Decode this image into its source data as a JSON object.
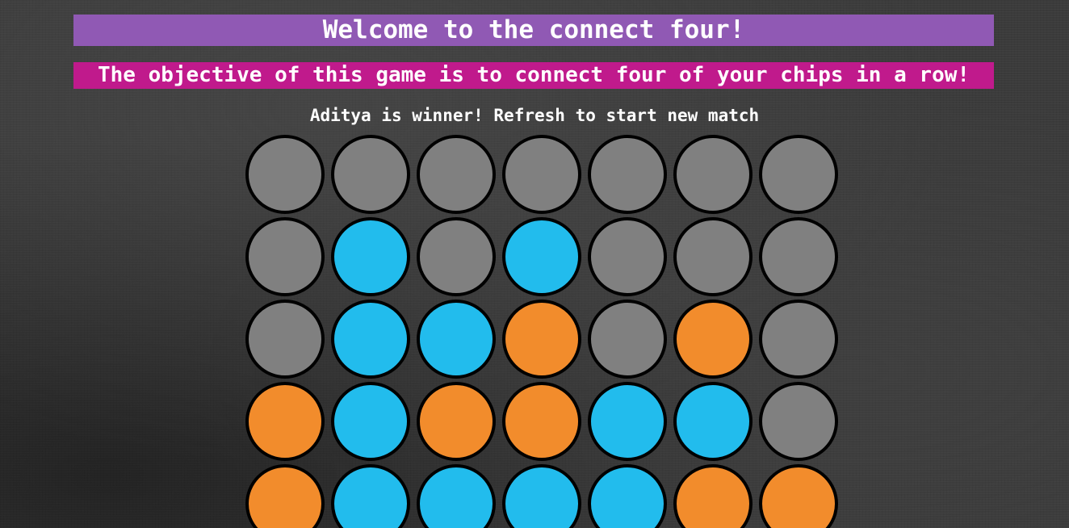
{
  "header": {
    "title": "Welcome to the connect four!",
    "subtitle": "The objective of this game is to connect four of your chips in a row!"
  },
  "status": {
    "message": "Aditya is winner! Refresh to start new match"
  },
  "colors": {
    "title_bg": "#9059b4",
    "subtitle_bg": "#c01a8c",
    "empty": "#808080",
    "blue": "#22bced",
    "orange": "#f28c2c",
    "cell_border": "#000000"
  },
  "board": {
    "rows": [
      [
        "empty",
        "empty",
        "empty",
        "empty",
        "empty",
        "empty",
        "empty"
      ],
      [
        "empty",
        "blue",
        "empty",
        "blue",
        "empty",
        "empty",
        "empty"
      ],
      [
        "empty",
        "blue",
        "blue",
        "orange",
        "empty",
        "orange",
        "empty"
      ],
      [
        "orange",
        "blue",
        "orange",
        "orange",
        "blue",
        "blue",
        "empty"
      ],
      [
        "orange",
        "blue",
        "blue",
        "blue",
        "blue",
        "orange",
        "orange"
      ]
    ]
  }
}
